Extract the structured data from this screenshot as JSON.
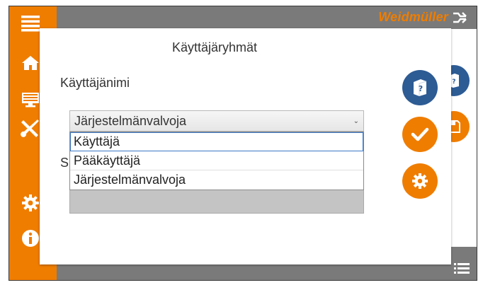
{
  "brand": {
    "name": "Weidmüller"
  },
  "colors": {
    "accent": "#ef7d00",
    "blue": "#2d5b94",
    "chrome": "#7a7a7a"
  },
  "sidebar": {
    "items": [
      {
        "icon": "menu-icon"
      },
      {
        "icon": "home-icon"
      },
      {
        "icon": "monitor-icon"
      },
      {
        "icon": "tools-icon"
      },
      {
        "icon": "gear-icon"
      },
      {
        "icon": "info-icon"
      }
    ]
  },
  "modal": {
    "title": "Käyttäjäryhmät",
    "username_label": "Käyttäjänimi",
    "second_label_initial": "S",
    "role_select": {
      "value": "Järjestelmänvalvoja",
      "options": [
        "Käyttäjä",
        "Pääkäyttäjä",
        "Järjestelmänvalvoja"
      ]
    }
  },
  "actions": [
    {
      "icon": "help-book-icon"
    },
    {
      "icon": "check-icon"
    },
    {
      "icon": "gear-icon"
    }
  ]
}
